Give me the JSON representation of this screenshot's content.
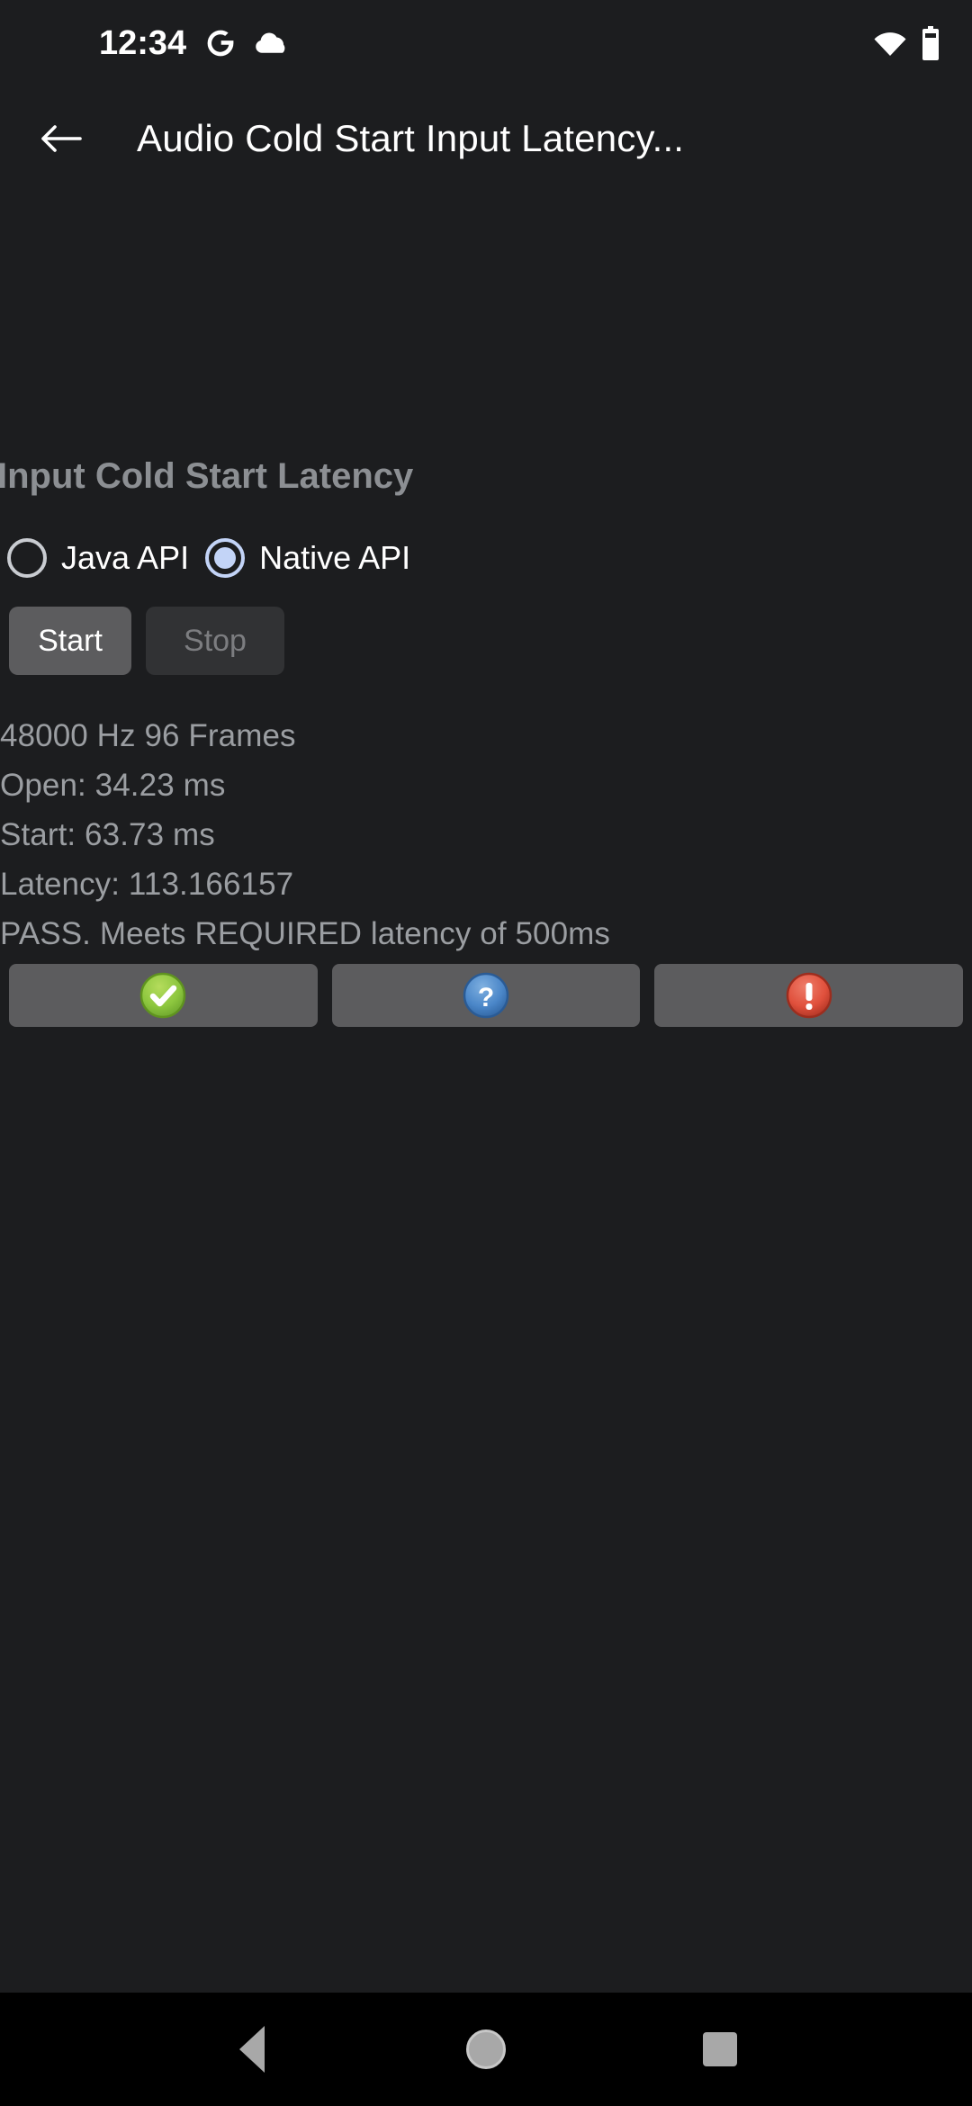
{
  "status_bar": {
    "clock": "12:34",
    "left_icons": [
      "google-icon",
      "cloud-icon"
    ],
    "right_icons": [
      "wifi-icon",
      "battery-icon"
    ]
  },
  "app_bar": {
    "back_icon": "arrow-back-icon",
    "title": "Audio Cold Start Input Latency..."
  },
  "main": {
    "heading": "Input Cold Start Latency",
    "api_options": [
      {
        "label": "Java API",
        "selected": false
      },
      {
        "label": "Native API",
        "selected": true
      }
    ],
    "controls": {
      "start_label": "Start",
      "start_enabled": true,
      "stop_label": "Stop",
      "stop_enabled": false
    },
    "results": [
      "48000 Hz 96 Frames",
      "Open: 34.23 ms",
      "Start: 63.73 ms",
      "Latency: 113.166157",
      "PASS. Meets REQUIRED latency of 500ms"
    ],
    "verdict_buttons": [
      {
        "icon": "pass-check-icon",
        "color": "#8cc63e"
      },
      {
        "icon": "info-question-icon",
        "color": "#4a86c8"
      },
      {
        "icon": "fail-exclaim-icon",
        "color": "#e0503c"
      }
    ]
  },
  "nav_bar": {
    "items": [
      {
        "icon": "nav-back-icon"
      },
      {
        "icon": "nav-home-icon"
      },
      {
        "icon": "nav-recents-icon"
      }
    ]
  },
  "colors": {
    "background": "#1c1d1f",
    "nav_background": "#000000",
    "heading_text": "#8c8f93",
    "body_text": "#9b9ea2",
    "accent_radio": "#c3d4f7",
    "button_enabled": "#5c5c5e",
    "button_disabled": "#313234"
  }
}
